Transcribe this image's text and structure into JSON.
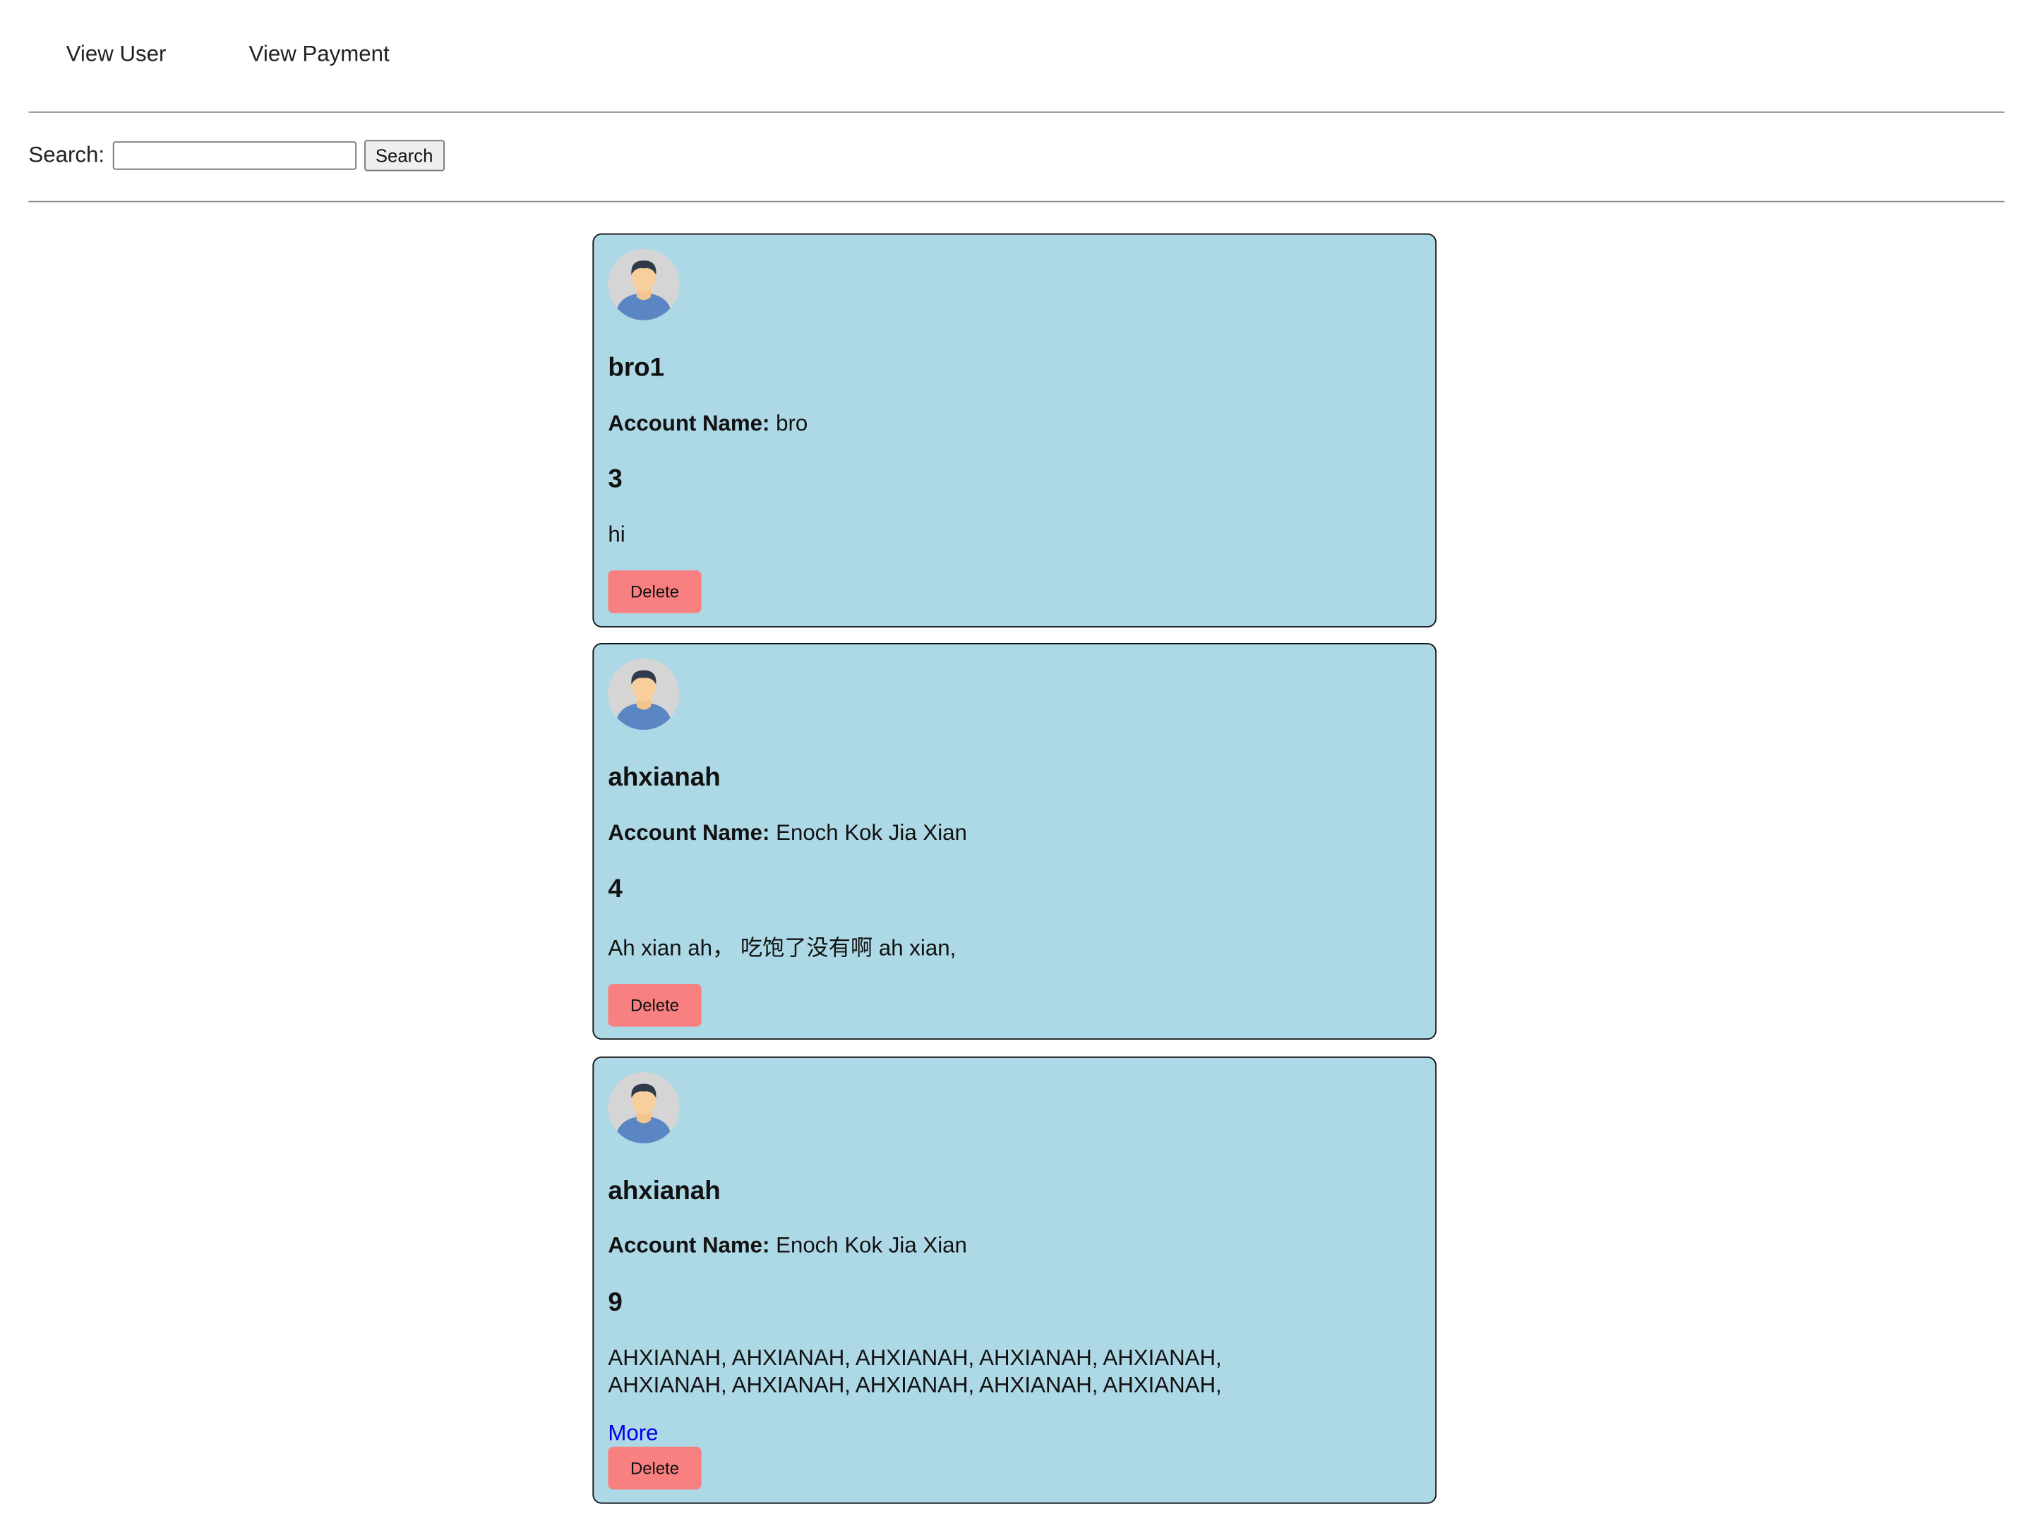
{
  "nav": {
    "view_user": "View User",
    "view_payment": "View Payment"
  },
  "search": {
    "label": "Search:",
    "value": "",
    "button": "Search"
  },
  "cards": [
    {
      "name": "bro1",
      "account_label": "Account Name:",
      "account_name": "bro",
      "number": "3",
      "message": "hi",
      "more": "",
      "delete": "Delete"
    },
    {
      "name": "ahxianah",
      "account_label": "Account Name:",
      "account_name": "Enoch Kok Jia Xian",
      "number": "4",
      "message": "Ah xian ah， 吃饱了没有啊 ah xian,",
      "more": "",
      "delete": "Delete"
    },
    {
      "name": "ahxianah",
      "account_label": "Account Name:",
      "account_name": "Enoch Kok Jia Xian",
      "number": "9",
      "message": "AHXIANAH, AHXIANAH, AHXIANAH, AHXIANAH, AHXIANAH, AHXIANAH, AHXIANAH, AHXIANAH, AHXIANAH, AHXIANAH,",
      "more": "More",
      "delete": "Delete"
    }
  ]
}
